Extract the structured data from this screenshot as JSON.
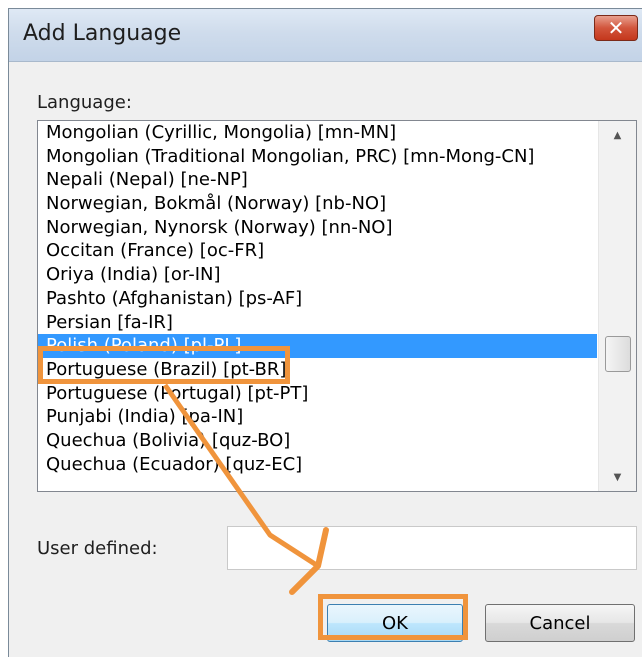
{
  "dialog": {
    "title": "Add Language",
    "close_glyph": "✕"
  },
  "language": {
    "label": "Language:",
    "items": [
      "Mongolian (Cyrillic, Mongolia) [mn-MN]",
      "Mongolian (Traditional Mongolian, PRC) [mn-Mong-CN]",
      "Nepali (Nepal) [ne-NP]",
      "Norwegian, Bokmål (Norway) [nb-NO]",
      "Norwegian, Nynorsk (Norway) [nn-NO]",
      "Occitan (France) [oc-FR]",
      "Oriya (India) [or-IN]",
      "Pashto (Afghanistan) [ps-AF]",
      "Persian [fa-IR]",
      "Polish (Poland) [pl-PL]",
      "Portuguese (Brazil) [pt-BR]",
      "Portuguese (Portugal) [pt-PT]",
      "Punjabi (India) [pa-IN]",
      "Quechua (Bolivia) [quz-BO]",
      "Quechua (Ecuador) [quz-EC]"
    ],
    "selected": "Polish (Poland) [pl-PL]"
  },
  "user_defined": {
    "label": "User defined:",
    "value": ""
  },
  "buttons": {
    "ok": "OK",
    "cancel": "Cancel"
  },
  "colors": {
    "selection": "#3399ff",
    "highlight": "#f0943c"
  },
  "icons": {
    "scroll_up": "▲",
    "scroll_down": "▼"
  }
}
